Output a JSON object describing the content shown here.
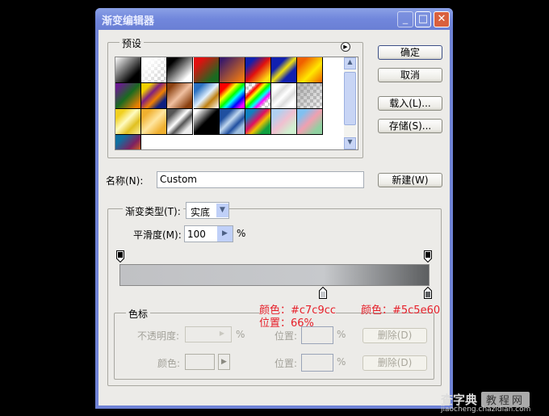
{
  "window": {
    "title": "渐变编辑器"
  },
  "presets": {
    "label": "预设",
    "swatches": [
      "linear-gradient(135deg,#fff,#000 75%)",
      "linear-gradient(135deg,#fff 20%,rgba(255,255,255,0))",
      "linear-gradient(135deg,#000 20%,#fff 80%)",
      "linear-gradient(135deg,#e01010 20%,#1a6a20 80%)",
      "linear-gradient(135deg,#3a1a6a 10%,#f07a10 90%)",
      "linear-gradient(135deg,#1020b0 20%,#e01010 50%,#ffe010 85%)",
      "linear-gradient(135deg,#1020b0 30%,#f0e010 50%,#1020b0 70%)",
      "linear-gradient(135deg,#f06000 20%,#ffe800 60%,#f06000)",
      "linear-gradient(135deg,#6a1a90 10%,#1a6a20 50%,#f08000 90%)",
      "linear-gradient(135deg,#f0d000 20%,#802080 40%,#f08000 60%,#102080 80%)",
      "linear-gradient(135deg,#8a4010 15%,#f0c0a0 50%,#8a4010 85%)",
      "linear-gradient(135deg,#2a70c0 20%,#e0f0ff 50%,#c08010 70%,#fff)",
      "linear-gradient(135deg,#f00 20%,#ff0 35%,#0f0 50%,#0ff 60%,#00f 75%,#f0f 90%)",
      "linear-gradient(135deg,transparent 20%,#f00 30%,#ff0 40%,#0f0 50%,#0ff 60%,#f0f 70%,transparent 80%)",
      "linear-gradient(135deg,#fff 20%,#ddd 35%,#fff 50%,#ddd 65%,#fff 80%)",
      "linear-gradient(135deg,rgba(128,128,128,.6),rgba(128,128,128,.1))",
      "linear-gradient(135deg,#f0d020 20%,#fffbc0 45%,#e0c020 70%,#fff0a0)",
      "linear-gradient(135deg,#f0b030 20%,#ffe6a0 50%,#f0b030 80%)",
      "linear-gradient(135deg,#555 20%,#fff 45%,#555 60%,#eee 80%)",
      "linear-gradient(135deg,#fff 10%,#000 50%,#000)",
      "linear-gradient(135deg,#2050a0 25%,#c0d8f0 45%,#2050a0 65%,#a0c0e0 80%)",
      "linear-gradient(135deg,#1080c0 20%,#e01060 45%,#f0c000 60%,#10a040 80%)",
      "linear-gradient(135deg,#b0d0f0 20%,#f0c0d0 50%,#d0f0d0 80%)",
      "linear-gradient(135deg,#80c0f0 20%,#f0a0b0 50%,#90d0a0 80%)",
      "linear-gradient(135deg,#1070a0 20%,#802060 55%,#f08000 90%)"
    ]
  },
  "buttons": {
    "ok": "确定",
    "cancel": "取消",
    "load": "载入(L)...",
    "save": "存储(S)...",
    "new": "新建(W)"
  },
  "name": {
    "label": "名称(N):",
    "value": "Custom"
  },
  "gradient_type": {
    "label": "渐变类型(T):",
    "value": "实底"
  },
  "smoothness": {
    "label": "平滑度(M):",
    "value": "100",
    "unit": "%"
  },
  "gradient": {
    "stops": [
      {
        "position": 0,
        "color": "#c0c1c4"
      },
      {
        "position": 66,
        "color": "#c7c9cc"
      },
      {
        "position": 100,
        "color": "#5c5e60"
      }
    ]
  },
  "annotations": {
    "stop1_color": "颜色：#c7c9cc",
    "stop1_position": "位置：66%",
    "stop2_color": "颜色：#5c5e60"
  },
  "stops_group": {
    "label": "色标",
    "opacity_label": "不透明度:",
    "opacity_unit": "%",
    "position_label": "位置:",
    "position_unit": "%",
    "delete": "删除(D)",
    "color_label": "颜色:"
  },
  "watermark": {
    "brand": "查字典",
    "tag": "教程网",
    "url": "jiaocheng.chazidian.com"
  }
}
